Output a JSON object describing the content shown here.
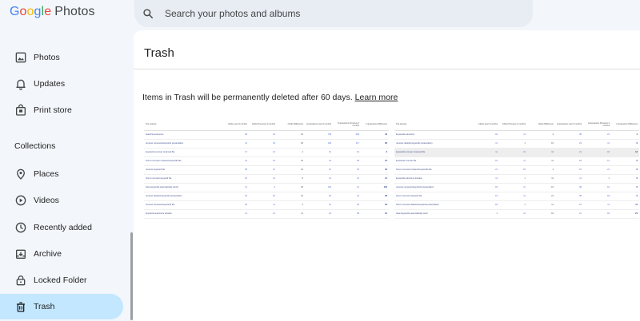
{
  "app": {
    "brand_letters": [
      "G",
      "o",
      "o",
      "g",
      "l",
      "e"
    ],
    "product": "Photos"
  },
  "search": {
    "placeholder": "Search your photos and albums"
  },
  "sidebar": {
    "items_top": [
      {
        "label": "Photos",
        "icon": "photo-icon"
      },
      {
        "label": "Updates",
        "icon": "bell-icon"
      },
      {
        "label": "Print store",
        "icon": "shopping-bag-icon"
      }
    ],
    "section_title": "Collections",
    "items_collections": [
      {
        "label": "Places",
        "icon": "location-pin-icon"
      },
      {
        "label": "Videos",
        "icon": "play-circle-icon"
      },
      {
        "label": "Recently added",
        "icon": "history-icon"
      },
      {
        "label": "Archive",
        "icon": "archive-icon"
      },
      {
        "label": "Locked Folder",
        "icon": "lock-icon"
      },
      {
        "label": "Trash",
        "icon": "trash-icon",
        "active": true
      }
    ]
  },
  "main": {
    "title": "Trash",
    "notice": "Items in Trash will be permanently deleted after 60 days.",
    "learn_more": "Learn more"
  },
  "thumbnails": [
    {
      "headers": [
        "Top queries",
        "Clicks Last 3 months",
        "Clicks Previous 3 months",
        "Clicks Difference",
        "Impressions Last 3 months",
        "Impressions Previous 3 months",
        "Impressions Difference"
      ],
      "rows": [
        [
          "bearchte autonome",
          "38",
          "19",
          "19",
          "746",
          "283",
          "43"
        ],
        [
          "remover renamed keywords presentation",
          "41",
          "23",
          "18",
          "129",
          "117",
          "62"
        ],
        [
          "keywords remover renamed file",
          "17",
          "21",
          "4",
          "61",
          "19",
          "3"
        ],
        [
          "how to remover renamed keywords file",
          "21",
          "19",
          "16",
          "34",
          "18",
          "21"
        ],
        [
          "remover keyword file",
          "38",
          "21",
          "19",
          "16",
          "19",
          "18"
        ],
        [
          "how to remover keyword file",
          "15",
          "21",
          "8",
          "21",
          "31",
          "14"
        ],
        [
          "clear keywords automatically words",
          "11",
          "3",
          "18",
          "129",
          "21",
          "164"
        ],
        [
          "remover deleted keywords presentation",
          "15",
          "15",
          "22",
          "18",
          "21",
          "28"
        ],
        [
          "remover renamed keywords file",
          "18",
          "11",
          "6",
          "21",
          "18",
          "18"
        ],
        [
          "keywords autonome location",
          "11",
          "21",
          "11",
          "22",
          "28",
          "21"
        ]
      ]
    },
    {
      "headers": [
        "Top queries",
        "Clicks Last 3 months",
        "Clicks Previous 3 months",
        "Clicks Difference",
        "Impressions Last 3 months",
        "Impressions Previous 3 months",
        "Impressions Difference"
      ],
      "rows": [
        [
          "keywords autonome",
          "18",
          "11",
          "4",
          "38",
          "21",
          "4"
        ],
        [
          "remover deleted keywords presentation",
          "11",
          "4",
          "16",
          "23",
          "11",
          "9"
        ],
        [
          "keywords remover renamed file",
          "11",
          "21",
          "11",
          "21",
          "18",
          "13"
        ],
        [
          "keywords remover file",
          "16",
          "11",
          "11",
          "18",
          "12",
          "6"
        ],
        [
          "how to remover renamed keywords file",
          "21",
          "18",
          "4",
          "16",
          "21",
          "8"
        ],
        [
          "keywords autonome location",
          "11",
          "4",
          "11",
          "11",
          "4",
          "9"
        ],
        [
          "remover renamed keywords presentation",
          "18",
          "11",
          "16",
          "38",
          "16",
          "6"
        ],
        [
          "how to remover keyword file",
          "16",
          "11",
          "21",
          "28",
          "18",
          "9"
        ],
        [
          "how to remover deleted keywords presentation",
          "18",
          "4",
          "11",
          "16",
          "11",
          "11"
        ],
        [
          "clear keywords automatically word",
          "4",
          "11",
          "18",
          "21",
          "18",
          "21"
        ]
      ],
      "highlight_row": 2
    }
  ]
}
